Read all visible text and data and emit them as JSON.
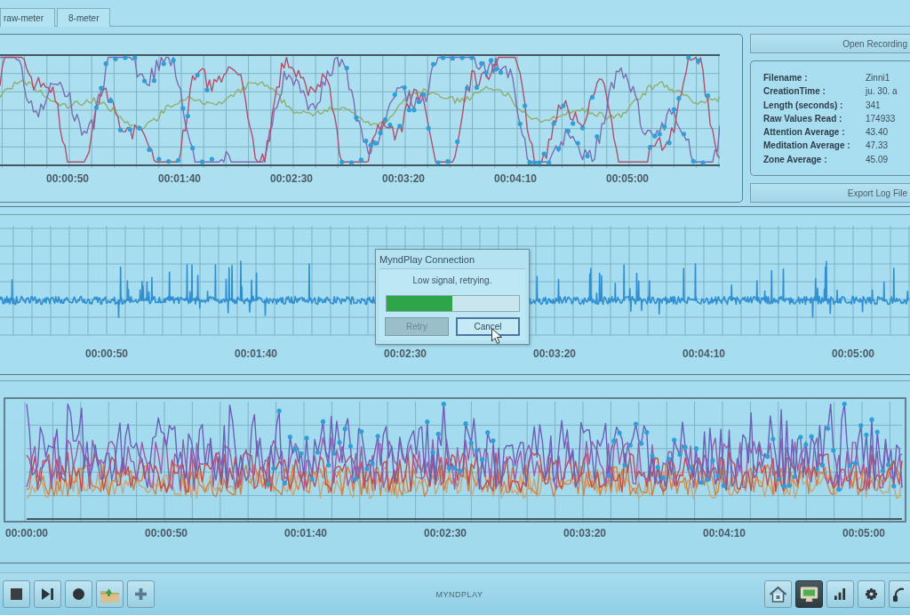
{
  "tabs": [
    {
      "label": "raw-meter"
    },
    {
      "label": "8-meter"
    }
  ],
  "charts": [
    {
      "kind": "smoothed",
      "time_labels": [
        "00:00:50",
        "00:01:40",
        "00:02:30",
        "00:03:20",
        "00:04:10",
        "00:05:00"
      ]
    },
    {
      "kind": "raw",
      "time_labels": [
        "00:00:50",
        "00:01:40",
        "00:02:30",
        "00:03:20",
        "00:04:10",
        "00:05:00"
      ]
    },
    {
      "kind": "bands",
      "time_labels": [
        "00:00:00",
        "00:00:50",
        "00:01:40",
        "00:02:30",
        "00:03:20",
        "00:04:10",
        "00:05:00"
      ]
    }
  ],
  "recording_panel": {
    "open_button": "Open Recording",
    "fields": [
      {
        "label": "Filename :",
        "value": "Zinni1"
      },
      {
        "label": "CreationTime :",
        "value": "ju. 30. a"
      },
      {
        "label": "Length (seconds) :",
        "value": "341"
      },
      {
        "label": "Raw Values Read :",
        "value": "174933"
      },
      {
        "label": "Attention Average :",
        "value": "43.40"
      },
      {
        "label": "Meditation Average :",
        "value": "47.33"
      },
      {
        "label": "Zone Average :",
        "value": "45.09"
      }
    ],
    "export_button": "Export Log File"
  },
  "dialog": {
    "title": "MyndPlay Connection",
    "message": "Low signal, retrying.",
    "progress": {
      "level": 0.5
    },
    "buttons": [
      {
        "label": "Retry",
        "disabled": true
      },
      {
        "label": "Cancel",
        "disabled": false
      }
    ]
  },
  "toolbar": {
    "left_buttons": [
      {
        "kind": "stop"
      },
      {
        "kind": "next"
      },
      {
        "kind": "record"
      },
      {
        "kind": "open"
      },
      {
        "kind": "add"
      }
    ],
    "logo": "MYNDPLAY",
    "right_buttons": [
      {
        "kind": "home",
        "selected": false
      },
      {
        "kind": "display",
        "selected": true
      },
      {
        "kind": "stats",
        "selected": false
      },
      {
        "kind": "settings",
        "selected": false
      },
      {
        "kind": "headset",
        "selected": false
      }
    ]
  }
}
